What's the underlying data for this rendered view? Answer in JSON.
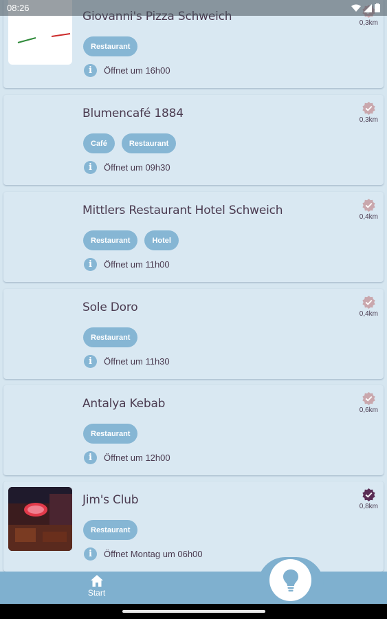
{
  "status_bar": {
    "time": "08:26"
  },
  "restaurants": [
    {
      "name": "Giovanni's Pizza Schweich",
      "tags": [
        "Restaurant"
      ],
      "hours": "Öffnet um 16h00",
      "distance": "0,3km",
      "verified": false,
      "thumbnail": "pizza-logo"
    },
    {
      "name": "Blumencafé 1884",
      "tags": [
        "Café",
        "Restaurant"
      ],
      "hours": "Öffnet um 09h30",
      "distance": "0,3km",
      "verified": false,
      "thumbnail": ""
    },
    {
      "name": "Mittlers Restaurant Hotel Schweich",
      "tags": [
        "Restaurant",
        "Hotel"
      ],
      "hours": "Öffnet um 11h00",
      "distance": "0,4km",
      "verified": false,
      "thumbnail": ""
    },
    {
      "name": "Sole Doro",
      "tags": [
        "Restaurant"
      ],
      "hours": "Öffnet um 11h30",
      "distance": "0,4km",
      "verified": false,
      "thumbnail": ""
    },
    {
      "name": "Antalya Kebab",
      "tags": [
        "Restaurant"
      ],
      "hours": "Öffnet um 12h00",
      "distance": "0,6km",
      "verified": false,
      "thumbnail": ""
    },
    {
      "name": "Jim's Club",
      "tags": [
        "Restaurant"
      ],
      "hours": "Öffnet Montag um 06h00",
      "distance": "0,8km",
      "verified": true,
      "thumbnail": "club-photo"
    }
  ],
  "bottom_nav": {
    "start_label": "Start",
    "start_icon": "home-icon",
    "fab_icon": "lightbulb-icon"
  },
  "colors": {
    "background": "#d6e6f0",
    "accent": "#7fb0cf",
    "tag": "#86b6d4",
    "text": "#4b3b50",
    "verified": "#5a2d55",
    "unverified": "#c9a7ad"
  }
}
